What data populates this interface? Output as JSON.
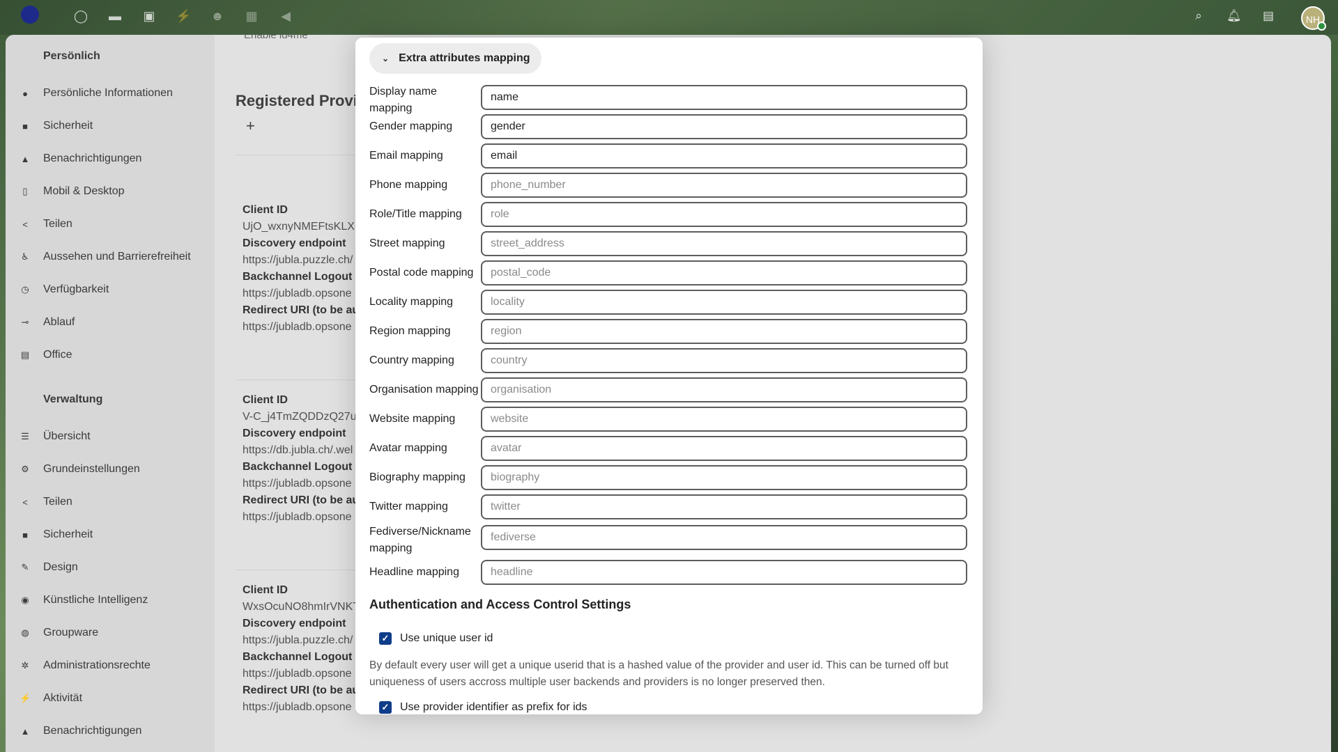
{
  "header": {
    "app_icons": [
      "dashboard-icon",
      "files-icon",
      "photos-icon",
      "activity-icon",
      "contacts-icon",
      "calendar-icon",
      "announcements-icon"
    ],
    "right_icons": [
      "search-icon",
      "notifications-icon",
      "contacts-menu-icon"
    ],
    "avatar_initials": "NH"
  },
  "sidebar": {
    "personal_heading": "Persönlich",
    "personal_items": [
      {
        "label": "Persönliche Informationen",
        "icon": "user-icon"
      },
      {
        "label": "Sicherheit",
        "icon": "lock-icon"
      },
      {
        "label": "Benachrichtigungen",
        "icon": "bell-icon"
      },
      {
        "label": "Mobil & Desktop",
        "icon": "phone-icon"
      },
      {
        "label": "Teilen",
        "icon": "share-icon"
      },
      {
        "label": "Aussehen und Barrierefreiheit",
        "icon": "accessibility-icon"
      },
      {
        "label": "Verfügbarkeit",
        "icon": "clock-icon"
      },
      {
        "label": "Ablauf",
        "icon": "flow-icon"
      },
      {
        "label": "Office",
        "icon": "document-icon"
      }
    ],
    "admin_heading": "Verwaltung",
    "admin_items": [
      {
        "label": "Übersicht",
        "icon": "list-icon"
      },
      {
        "label": "Grundeinstellungen",
        "icon": "gear-icon"
      },
      {
        "label": "Teilen",
        "icon": "share-icon"
      },
      {
        "label": "Sicherheit",
        "icon": "lock-icon"
      },
      {
        "label": "Design",
        "icon": "brush-icon"
      },
      {
        "label": "Künstliche Intelligenz",
        "icon": "ai-icon"
      },
      {
        "label": "Groupware",
        "icon": "groupware-icon"
      },
      {
        "label": "Administrationsrechte",
        "icon": "admin-gear-icon"
      },
      {
        "label": "Aktivität",
        "icon": "activity-icon"
      },
      {
        "label": "Benachrichtigungen",
        "icon": "bell-icon"
      }
    ]
  },
  "content": {
    "enable_text": "Enable id4me",
    "title": "Registered Provid",
    "providers": [
      {
        "client_id_label": "Client ID",
        "client_id": "UjO_wxnyNMEFtsKLXEI",
        "discovery_label": "Discovery endpoint",
        "discovery": "https://jubla.puzzle.ch/",
        "backchannel_label": "Backchannel Logout U",
        "backchannel": "https://jubladb.opsone",
        "redirect_label": "Redirect URI (to be au",
        "redirect": "https://jubladb.opsone"
      },
      {
        "client_id_label": "Client ID",
        "client_id": "V-C_j4TmZQDDzQ27uD",
        "discovery_label": "Discovery endpoint",
        "discovery": "https://db.jubla.ch/.wel",
        "backchannel_label": "Backchannel Logout U",
        "backchannel": "https://jubladb.opsone",
        "redirect_label": "Redirect URI (to be au",
        "redirect": "https://jubladb.opsone"
      },
      {
        "client_id_label": "Client ID",
        "client_id": "WxsOcuNO8hmIrVNKT",
        "discovery_label": "Discovery endpoint",
        "discovery": "https://jubla.puzzle.ch/",
        "backchannel_label": "Backchannel Logout U",
        "backchannel": "https://jubladb.opsone",
        "redirect_label": "Redirect URI (to be au",
        "redirect": "https://jubladb.opsone"
      }
    ]
  },
  "modal": {
    "collapse_label": "Extra attributes mapping",
    "fields": [
      {
        "label": "Display name mapping",
        "value": "name",
        "placeholder": ""
      },
      {
        "label": "Gender mapping",
        "value": "gender",
        "placeholder": ""
      },
      {
        "label": "Email mapping",
        "value": "email",
        "placeholder": ""
      },
      {
        "label": "Phone mapping",
        "value": "",
        "placeholder": "phone_number"
      },
      {
        "label": "Role/Title mapping",
        "value": "",
        "placeholder": "role"
      },
      {
        "label": "Street mapping",
        "value": "",
        "placeholder": "street_address"
      },
      {
        "label": "Postal code mapping",
        "value": "",
        "placeholder": "postal_code"
      },
      {
        "label": "Locality mapping",
        "value": "",
        "placeholder": "locality"
      },
      {
        "label": "Region mapping",
        "value": "",
        "placeholder": "region"
      },
      {
        "label": "Country mapping",
        "value": "",
        "placeholder": "country"
      },
      {
        "label": "Organisation mapping",
        "value": "",
        "placeholder": "organisation"
      },
      {
        "label": "Website mapping",
        "value": "",
        "placeholder": "website"
      },
      {
        "label": "Avatar mapping",
        "value": "",
        "placeholder": "avatar"
      },
      {
        "label": "Biography mapping",
        "value": "",
        "placeholder": "biography"
      },
      {
        "label": "Twitter mapping",
        "value": "",
        "placeholder": "twitter"
      },
      {
        "label": "Fediverse/Nickname mapping",
        "value": "",
        "placeholder": "fediverse"
      },
      {
        "label": "Headline mapping",
        "value": "",
        "placeholder": "headline"
      }
    ],
    "auth_section_title": "Authentication and Access Control Settings",
    "unique_user_id_label": "Use unique user id",
    "unique_user_id_checked": true,
    "unique_user_id_hint": "By default every user will get a unique userid that is a hashed value of the provider and user id. This can be turned off but uniqueness of users accross multiple user backends and providers is no longer preserved then.",
    "provider_prefix_label": "Use provider identifier as prefix for ids",
    "provider_prefix_checked": true
  }
}
